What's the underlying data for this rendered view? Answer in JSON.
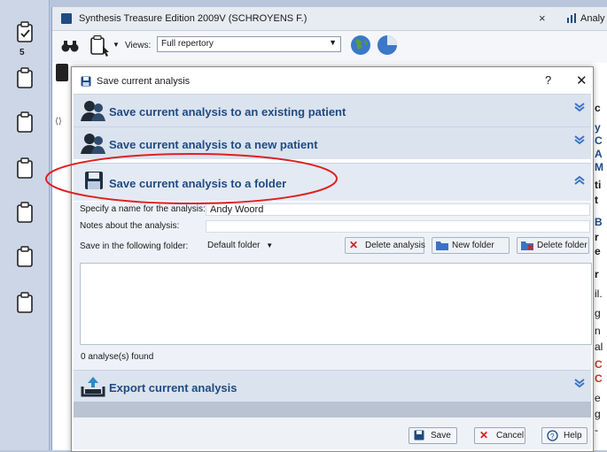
{
  "sidebar": {
    "count": "5"
  },
  "app": {
    "tab_title": "Synthesis Treasure Edition 2009V (SCHROYENS F.)",
    "tab_close": "×",
    "tab2_title": "Analy",
    "views_label": "Views:",
    "views_value": "Full repertory"
  },
  "right_fragments": [
    "c",
    "y",
    "C",
    "A",
    "M",
    "ti",
    "t",
    "B",
    "r",
    "e",
    "r",
    "il.",
    "g",
    "n",
    "al",
    "C",
    "C",
    "e",
    "g",
    "-"
  ],
  "dialog": {
    "title": "Save current analysis",
    "help": "?",
    "close": "✕",
    "sections": {
      "existing": "Save current analysis to an existing patient",
      "new_patient": "Save current analysis to a new patient",
      "folder": "Save current analysis to a folder",
      "export": "Export current analysis"
    },
    "form": {
      "name_label": "Specify a name for the analysis:",
      "name_value": "Andy Woord",
      "notes_label": "Notes about the analysis:",
      "notes_value": "",
      "folder_label": "Save in the following folder:",
      "folder_value": "Default folder",
      "delete_analysis": "Delete analysis",
      "new_folder": "New folder",
      "delete_folder": "Delete folder",
      "found": "0 analyse(s) found"
    },
    "footer": {
      "save": "Save",
      "cancel": "Cancel",
      "help": "Help"
    }
  },
  "colors": {
    "accent": "#1e4b84",
    "highlight": "#e02020"
  }
}
